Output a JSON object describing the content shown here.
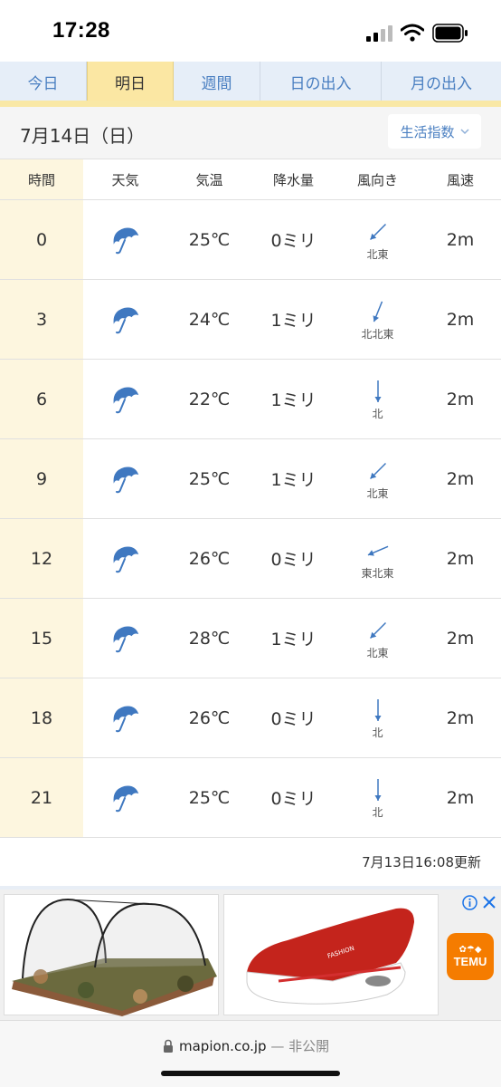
{
  "status": {
    "time": "17:28"
  },
  "tabs": [
    {
      "label": "今日",
      "active": false
    },
    {
      "label": "明日",
      "active": true
    },
    {
      "label": "週間",
      "active": false
    },
    {
      "label": "日の出入",
      "active": false
    },
    {
      "label": "月の出入",
      "active": false
    }
  ],
  "date_label": "7月14日（日）",
  "life_index_label": "生活指数",
  "table": {
    "headers": [
      "時間",
      "天気",
      "気温",
      "降水量",
      "風向き",
      "風速"
    ],
    "rows": [
      {
        "time": "0",
        "weather_icon": "umbrella-icon",
        "temp": "25℃",
        "rain": "0ミリ",
        "dir": "北東",
        "dir_angle": 225,
        "speed": "2m"
      },
      {
        "time": "3",
        "weather_icon": "umbrella-icon",
        "temp": "24℃",
        "rain": "1ミリ",
        "dir": "北北東",
        "dir_angle": 202,
        "speed": "2m"
      },
      {
        "time": "6",
        "weather_icon": "umbrella-icon",
        "temp": "22℃",
        "rain": "1ミリ",
        "dir": "北",
        "dir_angle": 180,
        "speed": "2m"
      },
      {
        "time": "9",
        "weather_icon": "umbrella-icon",
        "temp": "25℃",
        "rain": "1ミリ",
        "dir": "北東",
        "dir_angle": 225,
        "speed": "2m"
      },
      {
        "time": "12",
        "weather_icon": "umbrella-icon",
        "temp": "26℃",
        "rain": "0ミリ",
        "dir": "東北東",
        "dir_angle": 247,
        "speed": "2m"
      },
      {
        "time": "15",
        "weather_icon": "umbrella-icon",
        "temp": "28℃",
        "rain": "1ミリ",
        "dir": "北東",
        "dir_angle": 225,
        "speed": "2m"
      },
      {
        "time": "18",
        "weather_icon": "umbrella-icon",
        "temp": "26℃",
        "rain": "0ミリ",
        "dir": "北",
        "dir_angle": 180,
        "speed": "2m"
      },
      {
        "time": "21",
        "weather_icon": "umbrella-icon",
        "temp": "25℃",
        "rain": "0ミリ",
        "dir": "北",
        "dir_angle": 180,
        "speed": "2m"
      }
    ]
  },
  "updated": "7月13日16:08更新",
  "ad": {
    "brand": "TEMU",
    "shoe_text": "FASHION"
  },
  "urlbar": {
    "domain": "mapion.co.jp",
    "private": "— 非公開"
  },
  "colors": {
    "accent": "#4a7fc1",
    "active_tab": "#fbe7a3",
    "time_col": "#fdf6df",
    "icon_blue": "#3f78c0",
    "temu": "#f57c00"
  }
}
